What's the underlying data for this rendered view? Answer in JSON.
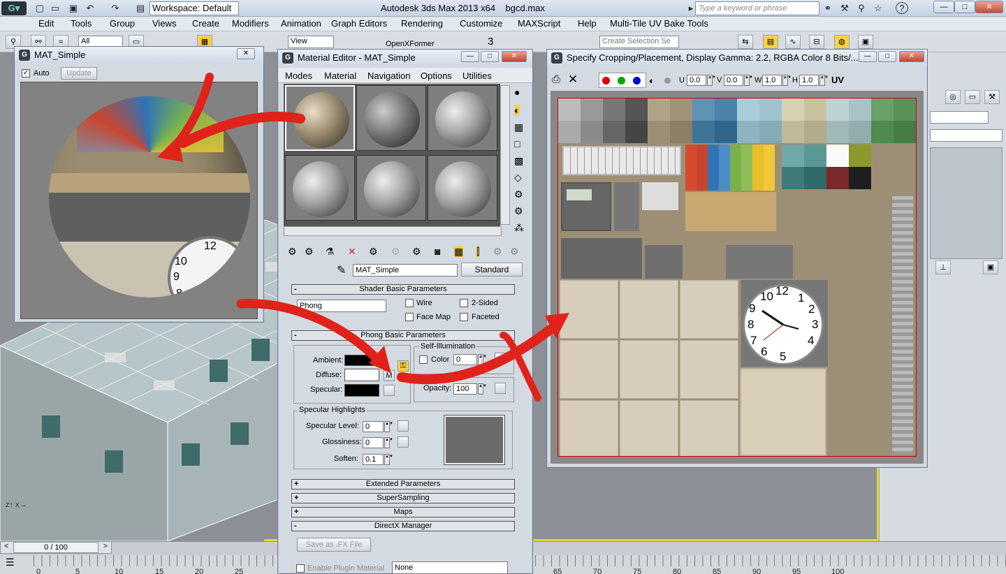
{
  "app": {
    "title": "Autodesk 3ds Max  2013 x64",
    "file": "bgcd.max",
    "workspace": "Workspace: Default",
    "search_placeholder": "Type a keyword or phrase"
  },
  "menu": [
    "Edit",
    "Tools",
    "Group",
    "Views",
    "Create",
    "Modifiers",
    "Animation",
    "Graph Editors",
    "Rendering",
    "Customize",
    "MAXScript",
    "Help",
    "Multi-Tile UV Bake Tools"
  ],
  "toolbar": {
    "filter": "All",
    "view": "View",
    "openxformer": "OpenXFormer",
    "selection_set": "Create Selection Se"
  },
  "preview_window": {
    "title": "MAT_Simple",
    "auto_label": "Auto",
    "update_label": "Update"
  },
  "mat_editor": {
    "title": "Material Editor - MAT_Simple",
    "menu": [
      "Modes",
      "Material",
      "Navigation",
      "Options",
      "Utilities"
    ],
    "material_name": "MAT_Simple",
    "type_button": "Standard",
    "rollouts": {
      "shader_basic": "Shader Basic Parameters",
      "phong_basic": "Phong Basic Parameters",
      "extended": "Extended Parameters",
      "supersampling": "SuperSampling",
      "maps": "Maps",
      "directx": "DirectX Manager"
    },
    "shader": "Phong",
    "wire": "Wire",
    "two_sided": "2-Sided",
    "face_map": "Face Map",
    "faceted": "Faceted",
    "self_illum": "Self-Illumination",
    "color_label": "Color",
    "color_value": "0",
    "ambient": "Ambient:",
    "diffuse": "Diffuse:",
    "specular": "Specular:",
    "m_button": "M",
    "opacity_label": "Opacity:",
    "opacity_value": "100",
    "spec_highlights": "Specular Highlights",
    "spec_level_label": "Specular Level:",
    "spec_level_value": "0",
    "gloss_label": "Glossiness:",
    "gloss_value": "0",
    "soften_label": "Soften:",
    "soften_value": "0.1",
    "save_fx": "Save as .FX File",
    "enable_plugin": "Enable Plugin Material",
    "plugin_value": "None"
  },
  "crop_window": {
    "title": "Specify Cropping/Placement, Display Gamma: 2.2, RGBA Color 8 Bits/...",
    "u_label": "U",
    "u_value": "0.0",
    "v_label": "V",
    "v_value": "0.0",
    "w_label": "W",
    "w_value": "1.0",
    "h_label": "H",
    "h_value": "1.0",
    "uv_label": "UV",
    "clock_numbers": [
      "12",
      "1",
      "2",
      "3",
      "4",
      "5",
      "6",
      "7",
      "8",
      "9",
      "10",
      "11"
    ]
  },
  "preview_clock_numbers": [
    "12",
    "10",
    "9",
    "8"
  ],
  "timeline": {
    "frame": "0 / 100",
    "ticks": [
      "0",
      "5",
      "10",
      "15",
      "20",
      "25",
      "65",
      "70",
      "75",
      "80",
      "85",
      "90",
      "95",
      "100"
    ]
  },
  "colors": {
    "arrow_red": "#e0231a",
    "viewport_frame": "#e8d52a"
  }
}
